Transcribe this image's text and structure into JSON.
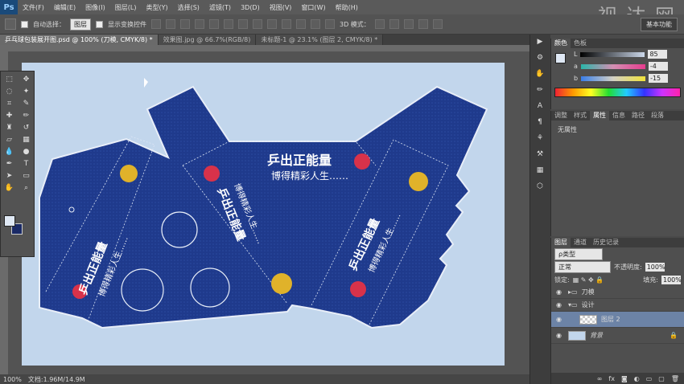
{
  "app": {
    "logo": "Ps",
    "watermark": "视 达 网"
  },
  "menu": [
    "文件(F)",
    "编辑(E)",
    "图像(I)",
    "图层(L)",
    "类型(Y)",
    "选择(S)",
    "滤镜(T)",
    "3D(D)",
    "视图(V)",
    "窗口(W)",
    "帮助(H)"
  ],
  "options": {
    "auto_select_label": "自动选择：",
    "auto_select_value": "图层",
    "show_transform_label": "显示变换控件",
    "mode_3d_label": "3D 模式：",
    "workspace": "基本功能"
  },
  "tabs": [
    {
      "label": "乒乓球包装展开图.psd @ 100% (刀模, CMYK/8) *",
      "active": true
    },
    {
      "label": "效果图.jpg @ 66.7%(RGB/8)",
      "active": false
    },
    {
      "label": "未标题-1 @ 23.1% (图层 2, CMYK/8) *",
      "active": false
    }
  ],
  "artwork": {
    "brand": "乒出正能量",
    "slogan": "博得精彩人生……"
  },
  "status": {
    "zoom": "100%",
    "doc": "文档:1.96M/14.9M"
  },
  "color_panel": {
    "tabs": [
      "颜色",
      "色板"
    ],
    "L": {
      "label": "L",
      "value": "85"
    },
    "a": {
      "label": "a",
      "value": "-4"
    },
    "b": {
      "label": "b",
      "value": "-15"
    }
  },
  "props_panel": {
    "tabs": [
      "调整",
      "样式",
      "属性",
      "信息",
      "路径",
      "段落"
    ],
    "content": "无属性"
  },
  "layers_panel": {
    "tabs": [
      "图层",
      "通道",
      "历史记录"
    ],
    "filter": "ρ类型",
    "blend": "正常",
    "opacity_label": "不透明度:",
    "opacity": "100%",
    "lock_label": "锁定:",
    "fill_label": "填充:",
    "fill": "100%",
    "layers": [
      {
        "name": "刀模",
        "type": "group",
        "selected": false
      },
      {
        "name": "设计",
        "type": "group",
        "selected": false
      },
      {
        "name": "图层 2",
        "type": "layer",
        "selected": true
      },
      {
        "name": "背景",
        "type": "background",
        "selected": false
      }
    ]
  },
  "colors": {
    "box_navy": "#1f3a8c",
    "box_border": "#e8eef8",
    "artboard_bg": "#c2d6ec",
    "ball_red": "#d8324a",
    "splash_gold": "#e0b22a"
  }
}
